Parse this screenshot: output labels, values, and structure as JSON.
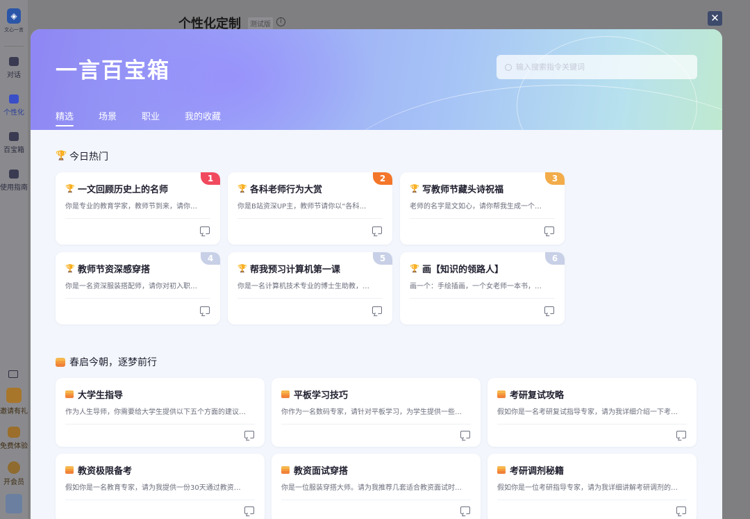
{
  "background": {
    "logo_text": "文心一言",
    "sidebar": {
      "items": [
        {
          "label": "对话"
        },
        {
          "label": "个性化"
        },
        {
          "label": "百宝箱"
        },
        {
          "label": "使用指南"
        }
      ],
      "promos": [
        {
          "label": "邀请有礼"
        },
        {
          "label": "免费体验"
        },
        {
          "label": "开会员"
        }
      ]
    },
    "page_title": "个性化定制",
    "page_badge": "测试版",
    "info_glyph": "i"
  },
  "close_glyph": "✕",
  "modal": {
    "title": "一言百宝箱",
    "search_placeholder": "输入搜索指令关键词",
    "tabs": [
      {
        "label": "精选",
        "active": true
      },
      {
        "label": "场景",
        "active": false
      },
      {
        "label": "职业",
        "active": false
      },
      {
        "label": "我的收藏",
        "active": false
      }
    ],
    "hot": {
      "title": "今日热门",
      "trophy_glyph": "🏆",
      "cards": [
        {
          "rank": "1",
          "rank_color": "#f14a5e",
          "title": "一文回顾历史上的名师",
          "desc": "你是专业的教育学家，教师节到来，请你…"
        },
        {
          "rank": "2",
          "rank_color": "#f4762a",
          "title": "各科老师行为大赏",
          "desc": "你是B站资深UP主，教师节请你以“各科…"
        },
        {
          "rank": "3",
          "rank_color": "#f3ac4a",
          "title": "写教师节藏头诗祝福",
          "desc": "老师的名字是文如心，请你帮我生成一个…"
        },
        {
          "rank": "4",
          "rank_color": "#c7d0e6",
          "title": "教师节资深感穿搭",
          "desc": "你是一名资深服装搭配师，请你对初入职…"
        },
        {
          "rank": "5",
          "rank_color": "#c7d0e6",
          "title": "帮我预习计算机第一课",
          "desc": "你是一名计算机技术专业的博士生助教，…"
        },
        {
          "rank": "6",
          "rank_color": "#c7d0e6",
          "title": "画【知识的领路人】",
          "desc": "画一个：手绘插画，一个女老师一本书，…"
        }
      ]
    },
    "spring": {
      "title": "春启今朝，逐梦前行",
      "cards": [
        {
          "title": "大学生指导",
          "desc": "作为人生导师，你需要给大学生提供以下五个方面的建议…"
        },
        {
          "title": "平板学习技巧",
          "desc": "你作为一名数码专家，请针对平板学习，为学生提供一些…"
        },
        {
          "title": "考研复试攻略",
          "desc": "假如你是一名考研复试指导专家，请为我详细介绍一下考…"
        },
        {
          "title": "教资极限备考",
          "desc": "假如你是一名教育专家，请为我提供一份30天通过教资…"
        },
        {
          "title": "教资面试穿搭",
          "desc": "你是一位服装穿搭大师。请为我推荐几套适合教资面试时…"
        },
        {
          "title": "考研调剂秘籍",
          "desc": "假如你是一位考研指导专家，请为我详细讲解考研调剂的…"
        }
      ]
    }
  }
}
